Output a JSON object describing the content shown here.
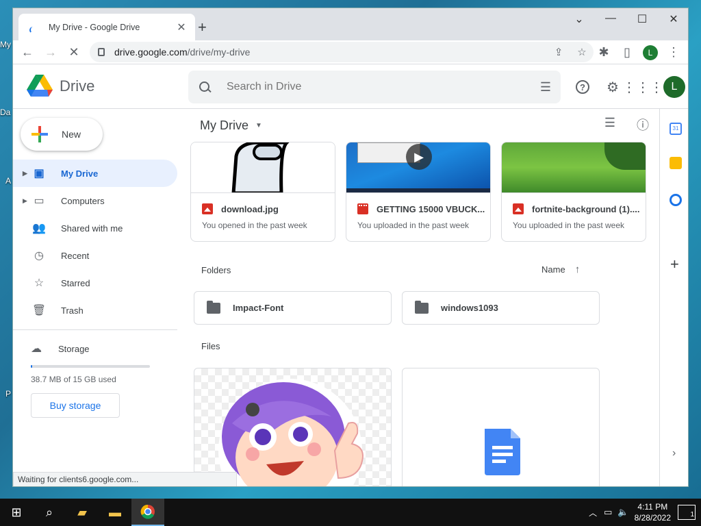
{
  "desktop": {
    "labels": [
      "My",
      "Da",
      "A",
      "P"
    ]
  },
  "browser": {
    "tab_title": "My Drive - Google Drive",
    "tab_close": "✕",
    "new_tab": "+",
    "window_controls": {
      "menu": "⌄",
      "minimize": "—",
      "maximize": "☐",
      "close": "✕"
    },
    "url_host": "drive.google.com",
    "url_path": "/drive/my-drive",
    "profile_initial": "L",
    "status": "Waiting for clients6.google.com..."
  },
  "drive": {
    "logo_text": "Drive",
    "search_placeholder": "Search in Drive",
    "avatar_initial": "L",
    "new_button": "New",
    "nav": [
      {
        "label": "My Drive",
        "icon": "my-drive-icon",
        "active": true
      },
      {
        "label": "Computers",
        "icon": "computers-icon"
      },
      {
        "label": "Shared with me",
        "icon": "shared-icon"
      },
      {
        "label": "Recent",
        "icon": "clock-icon"
      },
      {
        "label": "Starred",
        "icon": "star-icon"
      },
      {
        "label": "Trash",
        "icon": "trash-icon"
      }
    ],
    "storage": {
      "label": "Storage",
      "used_text": "38.7 MB of 15 GB used",
      "used_fraction": 0.003,
      "buy_label": "Buy storage"
    },
    "main_title": "My Drive",
    "suggested": [
      {
        "name": "download.jpg",
        "sub": "You opened in the past week",
        "type": "image"
      },
      {
        "name": "GETTING 15000 VBUCK...",
        "sub": "You uploaded in the past week",
        "type": "video"
      },
      {
        "name": "fortnite-background (1)....",
        "sub": "You uploaded in the past week",
        "type": "image"
      }
    ],
    "folders_heading": "Folders",
    "sort_label": "Name",
    "folders": [
      "Impact-Font",
      "windows1093"
    ],
    "files_heading": "Files",
    "colors": {
      "accent": "#1a73e8",
      "active_bg": "#e8f0fe",
      "file_red": "#d93025",
      "docs_blue": "#4285f4"
    }
  },
  "taskbar": {
    "time": "4:11 PM",
    "date": "8/28/2022",
    "notifications": "1"
  }
}
